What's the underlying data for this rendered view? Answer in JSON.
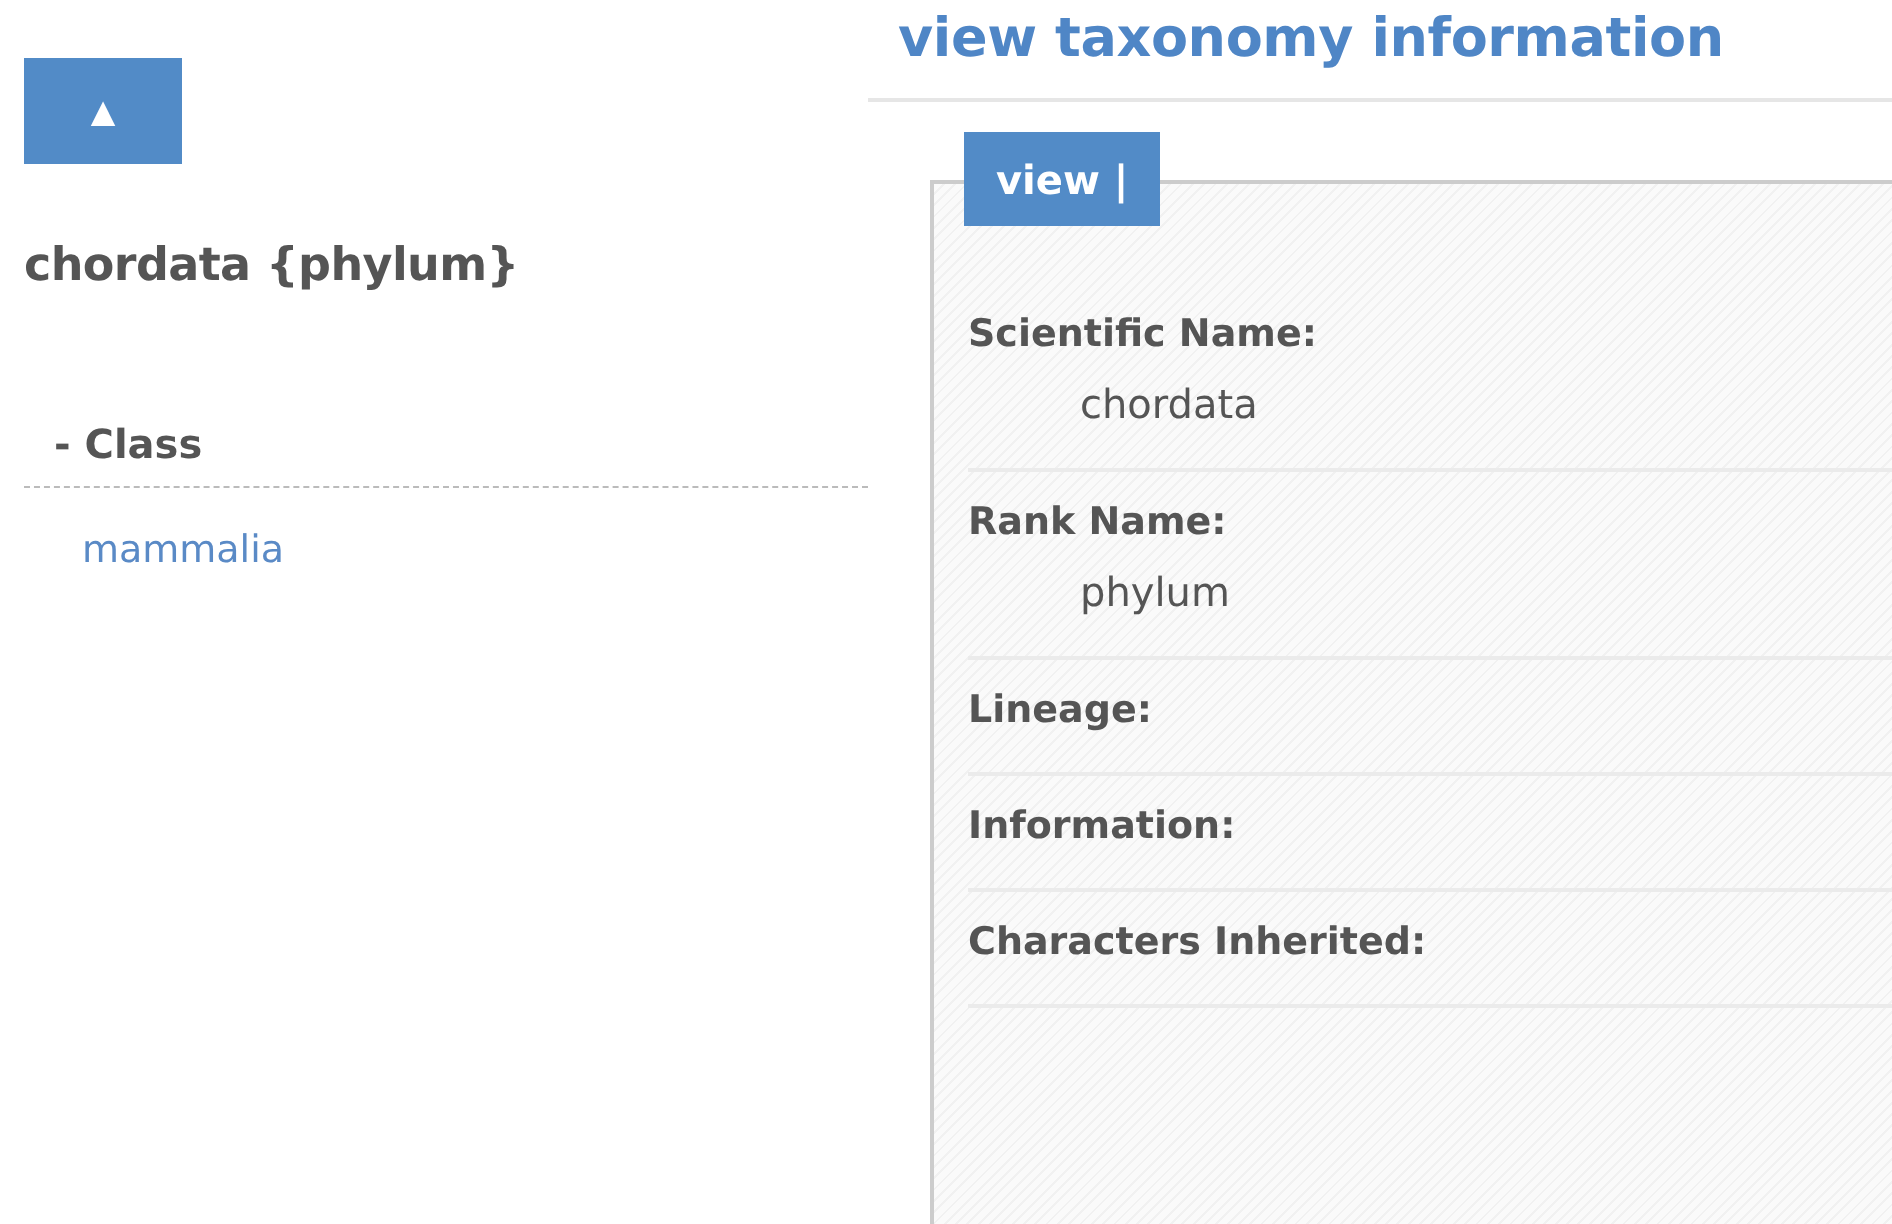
{
  "sidebar": {
    "up_button": "▲",
    "heading": "chordata {phylum}",
    "section": {
      "label": "- Class",
      "items": [
        "mammalia"
      ]
    }
  },
  "main": {
    "title": "view taxonomy information",
    "tabs": [
      {
        "label": "view |",
        "selected": true
      }
    ],
    "fields": [
      {
        "label": "Scientific Name:",
        "value": "chordata"
      },
      {
        "label": "Rank Name:",
        "value": "phylum"
      },
      {
        "label": "Lineage:"
      },
      {
        "label": "Information:"
      },
      {
        "label": "Characters Inherited:"
      }
    ]
  }
}
